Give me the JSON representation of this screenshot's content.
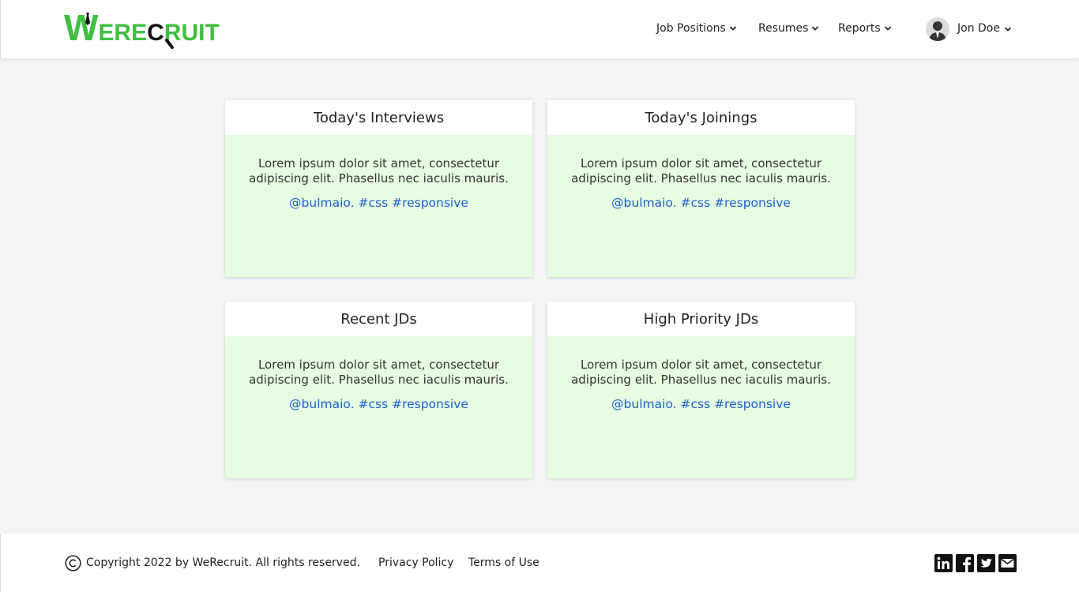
{
  "brand": {
    "logo_first": "W",
    "logo_mid": "ERE",
    "logo_c": "C",
    "logo_end": "RUIT",
    "green": "#3fbf3f"
  },
  "nav": {
    "items": [
      {
        "label": "Job Positions",
        "icon": "chevron-down-icon"
      },
      {
        "label": "Resumes",
        "icon": "chevron-down-icon"
      },
      {
        "label": "Reports",
        "icon": "chevron-down-icon"
      }
    ],
    "user": {
      "name": "Jon Doe",
      "avatar_icon": "user-avatar-icon"
    }
  },
  "cards": [
    {
      "title": "Today's Interviews",
      "text": "Lorem ipsum dolor sit amet, consectetur adipiscing elit. Phasellus nec iaculis mauris.",
      "tags": "@bulmaio. #css #responsive"
    },
    {
      "title": "Today's Joinings",
      "text": "Lorem ipsum dolor sit amet, consectetur adipiscing elit. Phasellus nec iaculis mauris.",
      "tags": "@bulmaio. #css #responsive"
    },
    {
      "title": "Recent JDs",
      "text": "Lorem ipsum dolor sit amet, consectetur adipiscing elit. Phasellus nec iaculis mauris.",
      "tags": "@bulmaio. #css #responsive"
    },
    {
      "title": "High Priority JDs",
      "text": "Lorem ipsum dolor sit amet, consectetur adipiscing elit. Phasellus nec iaculis mauris.",
      "tags": "@bulmaio. #css #responsive"
    }
  ],
  "footer": {
    "copyright": "Copyright 2022 by WeRecruit. All rights reserved.",
    "links": [
      "Privacy Policy",
      "Terms of Use"
    ],
    "social_icons": [
      "linkedin-icon",
      "facebook-icon",
      "twitter-icon",
      "email-icon"
    ]
  },
  "colors": {
    "card_body_bg": "#e6fde2",
    "link_blue": "#1f5fc7",
    "page_bg": "#f3f4f6"
  }
}
